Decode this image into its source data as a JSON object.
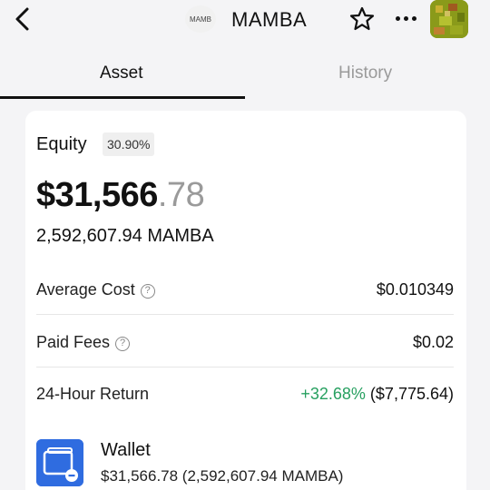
{
  "header": {
    "token_logo_text": "MAMB",
    "token_name": "MAMBA"
  },
  "tabs": [
    {
      "label": "Asset",
      "active": true
    },
    {
      "label": "History",
      "active": false
    }
  ],
  "equity": {
    "label": "Equity",
    "percent": "30.90%",
    "balance_main": "$31,566",
    "balance_cents": ".78",
    "token_amount": "2,592,607.94 MAMBA"
  },
  "details": {
    "average_cost": {
      "label": "Average Cost",
      "value": "$0.010349"
    },
    "paid_fees": {
      "label": "Paid Fees",
      "value": "$0.02"
    },
    "return_24h": {
      "label": "24-Hour Return",
      "change": "+32.68%",
      "amount": "($7,775.64)"
    }
  },
  "wallet": {
    "title": "Wallet",
    "value": "$31,566.78 (2,592,607.94 MAMBA)"
  },
  "colors": {
    "accent_green": "#27a060",
    "wallet_blue": "#2f6ce0",
    "muted": "#9a9a9a"
  }
}
